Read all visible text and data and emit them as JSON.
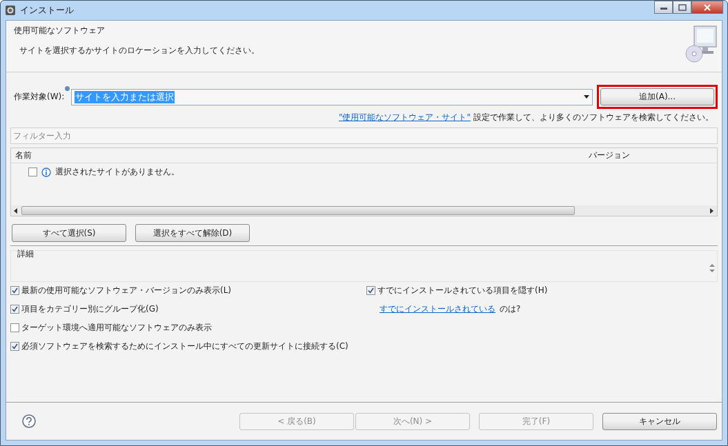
{
  "window": {
    "title": "インストール"
  },
  "header": {
    "title": "使用可能なソフトウェア",
    "description": "サイトを選択するかサイトのロケーションを入力してください。"
  },
  "work_with": {
    "label": "作業対象(W):",
    "value": "サイトを入力または選択",
    "add_button": {
      "label": "追加(A)...",
      "highlighted": true
    }
  },
  "sites_hint": {
    "link": "\"使用可能なソフトウェア・サイト\"",
    "text": "設定で作業して、より多くのソフトウェアを検索してください。"
  },
  "filter": {
    "placeholder": "フィルター入力"
  },
  "table": {
    "columns": [
      "名前",
      "バージョン"
    ],
    "rows": [
      {
        "name": "選択されたサイトがありません。",
        "checked": false
      }
    ]
  },
  "select_buttons": [
    "すべて選択(S)",
    "選択をすべて解除(D)"
  ],
  "details": {
    "label": "詳細"
  },
  "options_left": [
    {
      "label": "最新の使用可能なソフトウェア・バージョンのみ表示(L)",
      "checked": true
    },
    {
      "label": "項目をカテゴリー別にグループ化(G)",
      "checked": true
    },
    {
      "label": "ターゲット環境へ適用可能なソフトウェアのみ表示",
      "checked": false
    },
    {
      "label": "必須ソフトウェアを検索するためにインストール中にすべての更新サイトに接続する(C)",
      "checked": true
    }
  ],
  "options_right": [
    {
      "label": "すでにインストールされている項目を隠す(H)",
      "checked": true
    }
  ],
  "installed_hint": {
    "link": "すでにインストールされている",
    "text": "のは?"
  },
  "footer_buttons": [
    {
      "label": "< 戻る(B)",
      "disabled": true
    },
    {
      "label": "次へ(N) >",
      "disabled": true
    },
    {
      "label": "完了(F)",
      "disabled": true
    },
    {
      "label": "キャンセル",
      "disabled": false
    }
  ]
}
